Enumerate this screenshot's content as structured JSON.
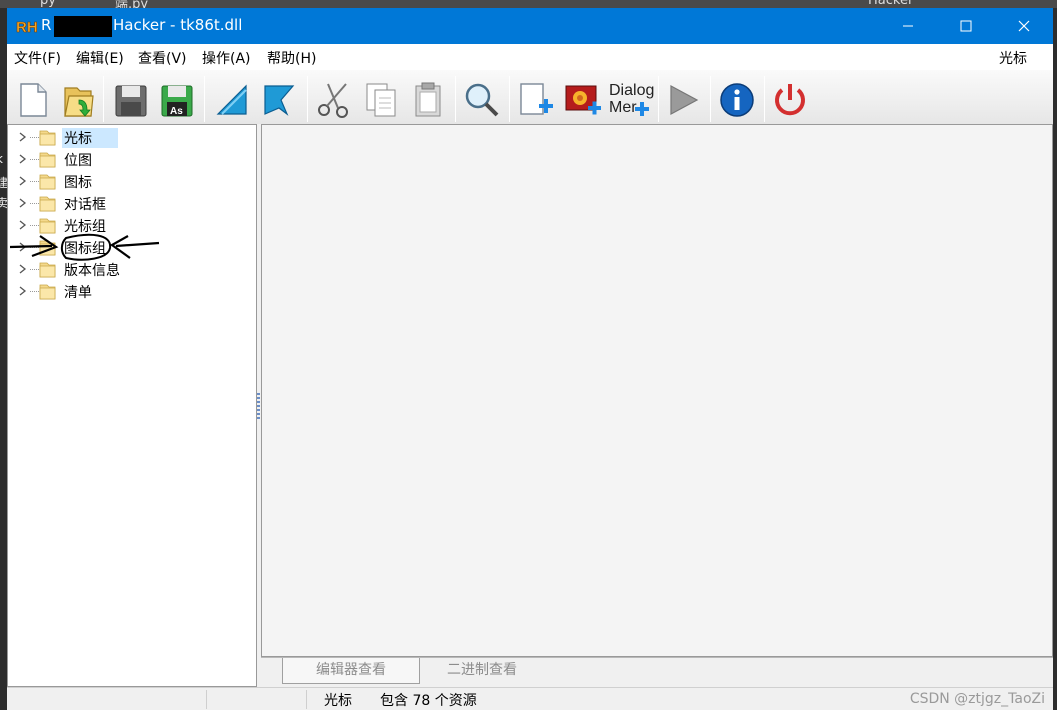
{
  "background": {
    "top_fragments": [
      "py",
      "端.py",
      "Hacker"
    ],
    "left_fragments": [
      "k",
      "建",
      "卖"
    ]
  },
  "window": {
    "title_prefix": "R",
    "title_suffix": "Hacker - tk86t.dll",
    "title_bar_color": "#0078d7",
    "controls": [
      "minimize-icon",
      "maximize-icon",
      "close-icon"
    ]
  },
  "menu": {
    "items": [
      "文件(F)",
      "编辑(E)",
      "查看(V)",
      "操作(A)",
      "帮助(H)"
    ],
    "right_label": "光标"
  },
  "toolbar": {
    "buttons": [
      "new-file-icon",
      "open-folder-icon",
      "save-icon",
      "save-as-icon",
      "compile-icon",
      "go-to-icon",
      "cut-icon",
      "copy-icon",
      "paste-icon",
      "find-icon",
      "add-resource-icon",
      "add-image-icon",
      "dialog-merge-icon",
      "run-icon",
      "info-icon",
      "exit-icon"
    ],
    "save_as_badge": "As",
    "dialog_label_line1": "Dialog",
    "dialog_label_line2": "Mer"
  },
  "tree": {
    "items": [
      "光标",
      "位图",
      "图标",
      "对话框",
      "光标组",
      "图标组",
      "版本信息",
      "清单"
    ],
    "selected": "光标",
    "folder_color": "#f4d98c"
  },
  "tabs": [
    "编辑器查看",
    "二进制查看"
  ],
  "status": {
    "section": "光标",
    "summary": "包含 78 个资源"
  },
  "watermark": "CSDN @ztjgz_TaoZi"
}
